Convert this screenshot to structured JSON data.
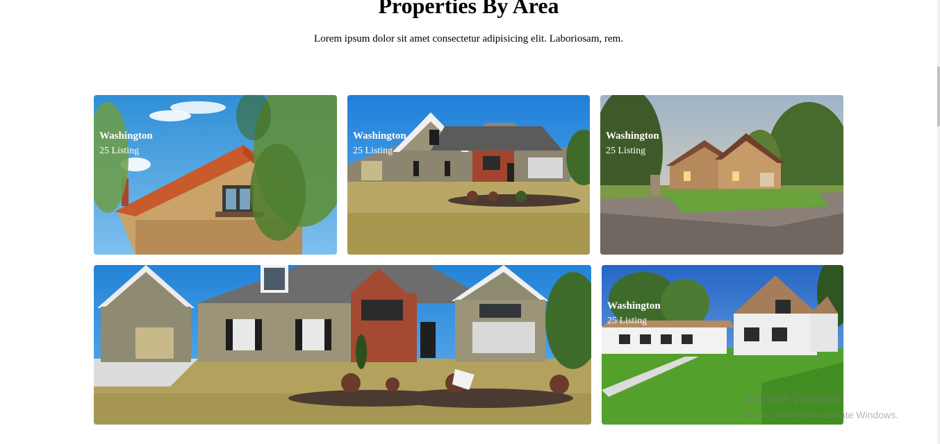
{
  "section": {
    "title": "Properties By Area",
    "subtitle": "Lorem ipsum dolor sit amet consectetur adipisicing elit. Laboriosam, rem."
  },
  "cards": [
    {
      "city": "Washington",
      "count": "25 Listing",
      "show_caption": true
    },
    {
      "city": "Washington",
      "count": "25 Listing",
      "show_caption": true
    },
    {
      "city": "Washington",
      "count": "25 Listing",
      "show_caption": true
    },
    {
      "city": "",
      "count": "",
      "show_caption": false
    },
    {
      "city": "Washington",
      "count": "25 Listing",
      "show_caption": true
    }
  ],
  "watermark": {
    "title": "Activate Windows",
    "subtitle": "Go to Settings to activate Windows."
  }
}
